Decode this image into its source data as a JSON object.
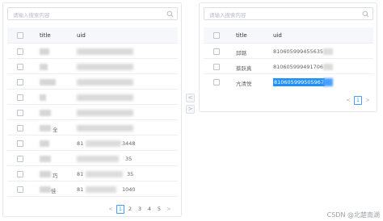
{
  "left": {
    "search_placeholder": "请输入搜索内容",
    "header": {
      "title": "title",
      "uid": "uid"
    },
    "rows": [
      {
        "title": "",
        "uid": ""
      },
      {
        "title": "",
        "uid": ""
      },
      {
        "title": "",
        "uid": ""
      },
      {
        "title": "",
        "uid": ""
      },
      {
        "title": "",
        "uid": ""
      },
      {
        "title": "全",
        "uid": ""
      },
      {
        "title": "",
        "uid": "81"
      },
      {
        "title": "",
        "uid": ""
      },
      {
        "title": "巧",
        "uid": "81"
      },
      {
        "title": "佳",
        "uid": "81"
      }
    ],
    "uid_tails": [
      "",
      "",
      "",
      "",
      "",
      "",
      "3448",
      "35",
      "35",
      "1040"
    ],
    "pages": [
      "1",
      "2",
      "3",
      "4",
      "5"
    ],
    "active_page": "1",
    "prev": "<",
    "next": ">"
  },
  "right": {
    "search_placeholder": "请输入搜索内容",
    "header": {
      "title": "title",
      "uid": "uid"
    },
    "rows": [
      {
        "title": "邱璐",
        "uid": "810605999455635"
      },
      {
        "title": "蔡跃真",
        "uid": "810605999491706"
      },
      {
        "title": "亢清悦",
        "uid": "810605999505967"
      }
    ],
    "pages": [
      "1"
    ],
    "active_page": "1",
    "prev": "<",
    "next": ">"
  },
  "transfer": {
    "to_left": "<",
    "to_right": ">"
  },
  "watermark": "CSDN @北楚南湖",
  "colors": {
    "accent": "#409eff",
    "selection": "#1e90ff",
    "border": "#e4e7ed",
    "header_bg": "#f5f7fa"
  }
}
